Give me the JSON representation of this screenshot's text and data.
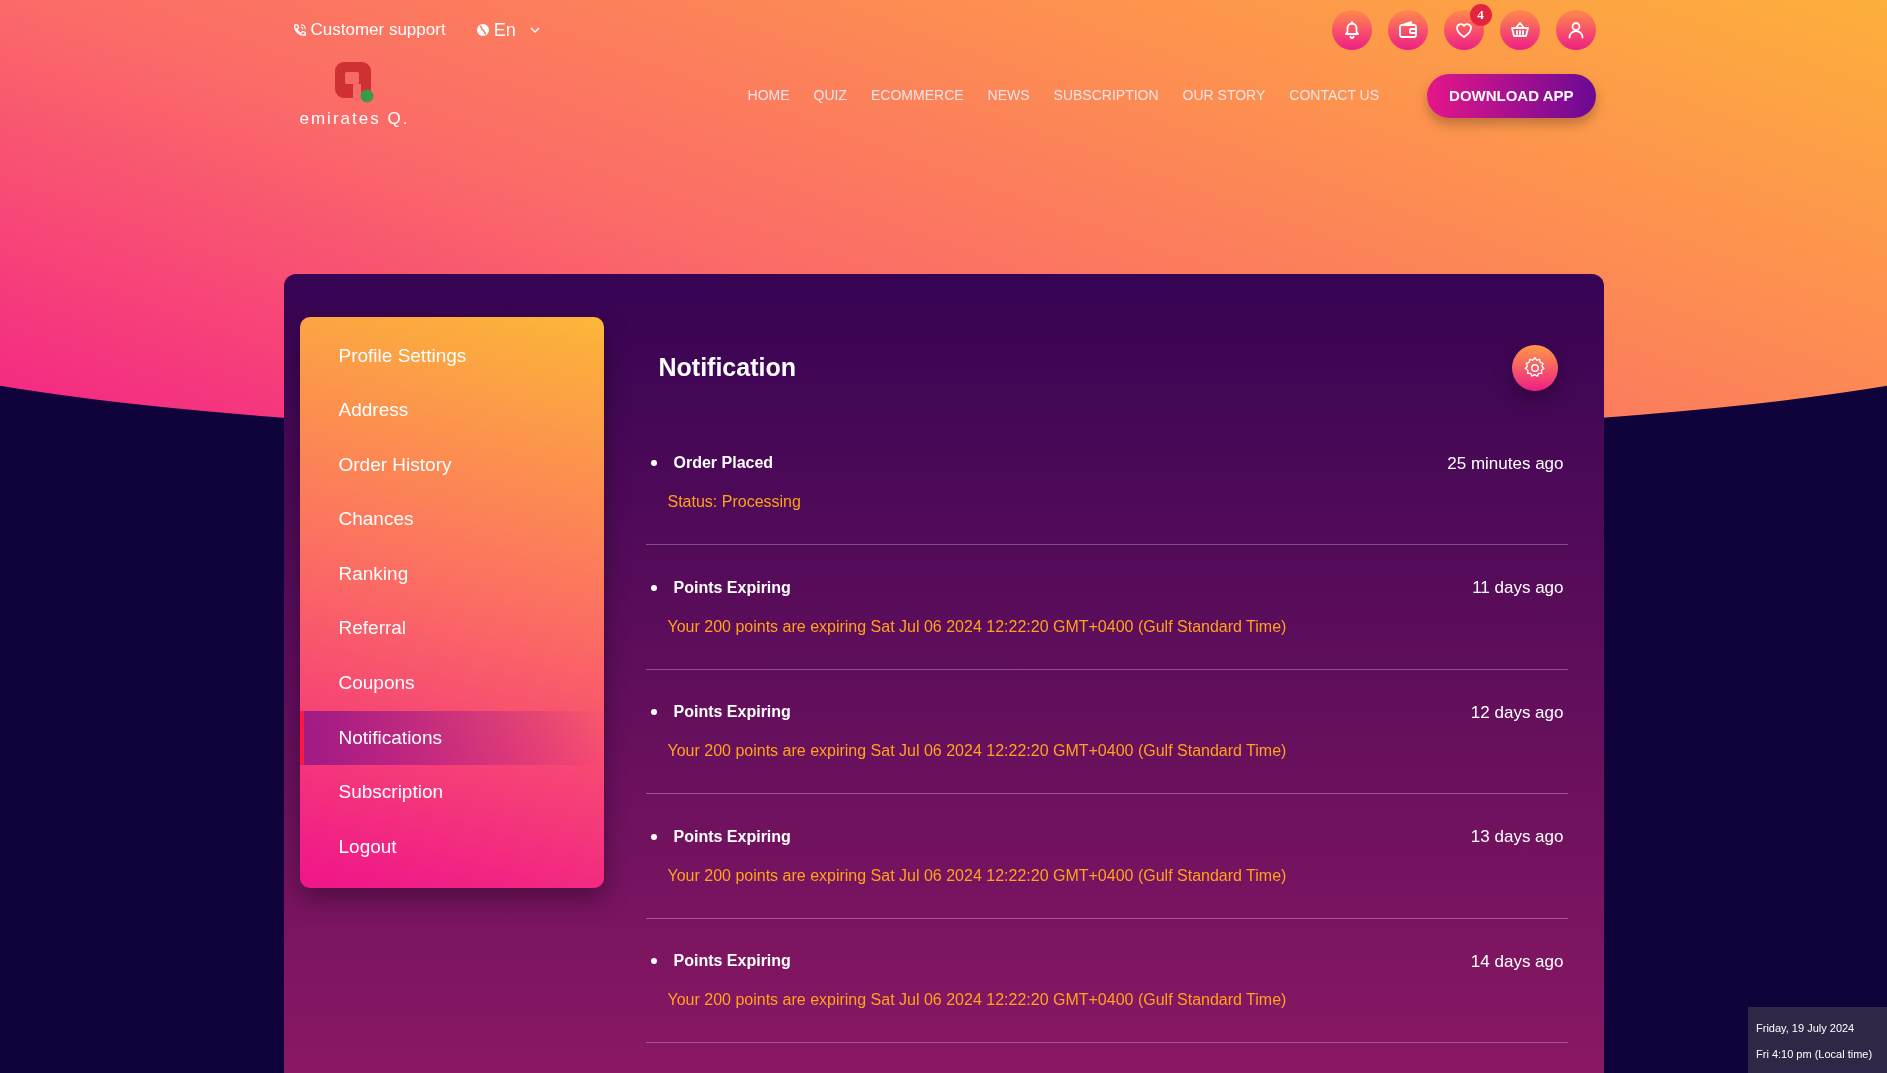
{
  "top_bar": {
    "support_link": "Customer support",
    "language": "En"
  },
  "header_icons": [
    {
      "kind": "bell"
    },
    {
      "kind": "wallet"
    },
    {
      "kind": "heart",
      "badge": "4"
    },
    {
      "kind": "basket"
    },
    {
      "kind": "user"
    }
  ],
  "logo": {
    "text": "emirates Q."
  },
  "nav": [
    "HOME",
    "QUIZ",
    "ECOMMERCE",
    "NEWS",
    "SUBSCRIPTION",
    "OUR STORY",
    "CONTACT US"
  ],
  "download_button": "DOWNLOAD APP",
  "sidebar": {
    "items": [
      {
        "label": "Profile Settings",
        "selected": false
      },
      {
        "label": "Address",
        "selected": false
      },
      {
        "label": "Order History",
        "selected": false
      },
      {
        "label": "Chances",
        "selected": false
      },
      {
        "label": "Ranking",
        "selected": false
      },
      {
        "label": "Referral",
        "selected": false
      },
      {
        "label": "Coupons",
        "selected": false
      },
      {
        "label": "Notifications",
        "selected": true
      },
      {
        "label": "Subscription",
        "selected": false
      },
      {
        "label": "Logout",
        "selected": false
      }
    ]
  },
  "notifications": {
    "title": "Notification",
    "items": [
      {
        "title": "Order Placed",
        "time": "25 minutes ago",
        "message": "Status: Processing"
      },
      {
        "title": "Points Expiring",
        "time": "11 days ago",
        "message": "Your 200 points are expiring Sat Jul 06 2024 12:22:20 GMT+0400 (Gulf Standard Time)"
      },
      {
        "title": "Points Expiring",
        "time": "12 days ago",
        "message": "Your 200 points are expiring Sat Jul 06 2024 12:22:20 GMT+0400 (Gulf Standard Time)"
      },
      {
        "title": "Points Expiring",
        "time": "13 days ago",
        "message": "Your 200 points are expiring Sat Jul 06 2024 12:22:20 GMT+0400 (Gulf Standard Time)"
      },
      {
        "title": "Points Expiring",
        "time": "14 days ago",
        "message": "Your 200 points are expiring Sat Jul 06 2024 12:22:20 GMT+0400 (Gulf Standard Time)"
      }
    ]
  },
  "datetime_tooltip": {
    "date": "Friday, 19 July 2024",
    "time": "Fri 4:10 pm (Local time)"
  }
}
